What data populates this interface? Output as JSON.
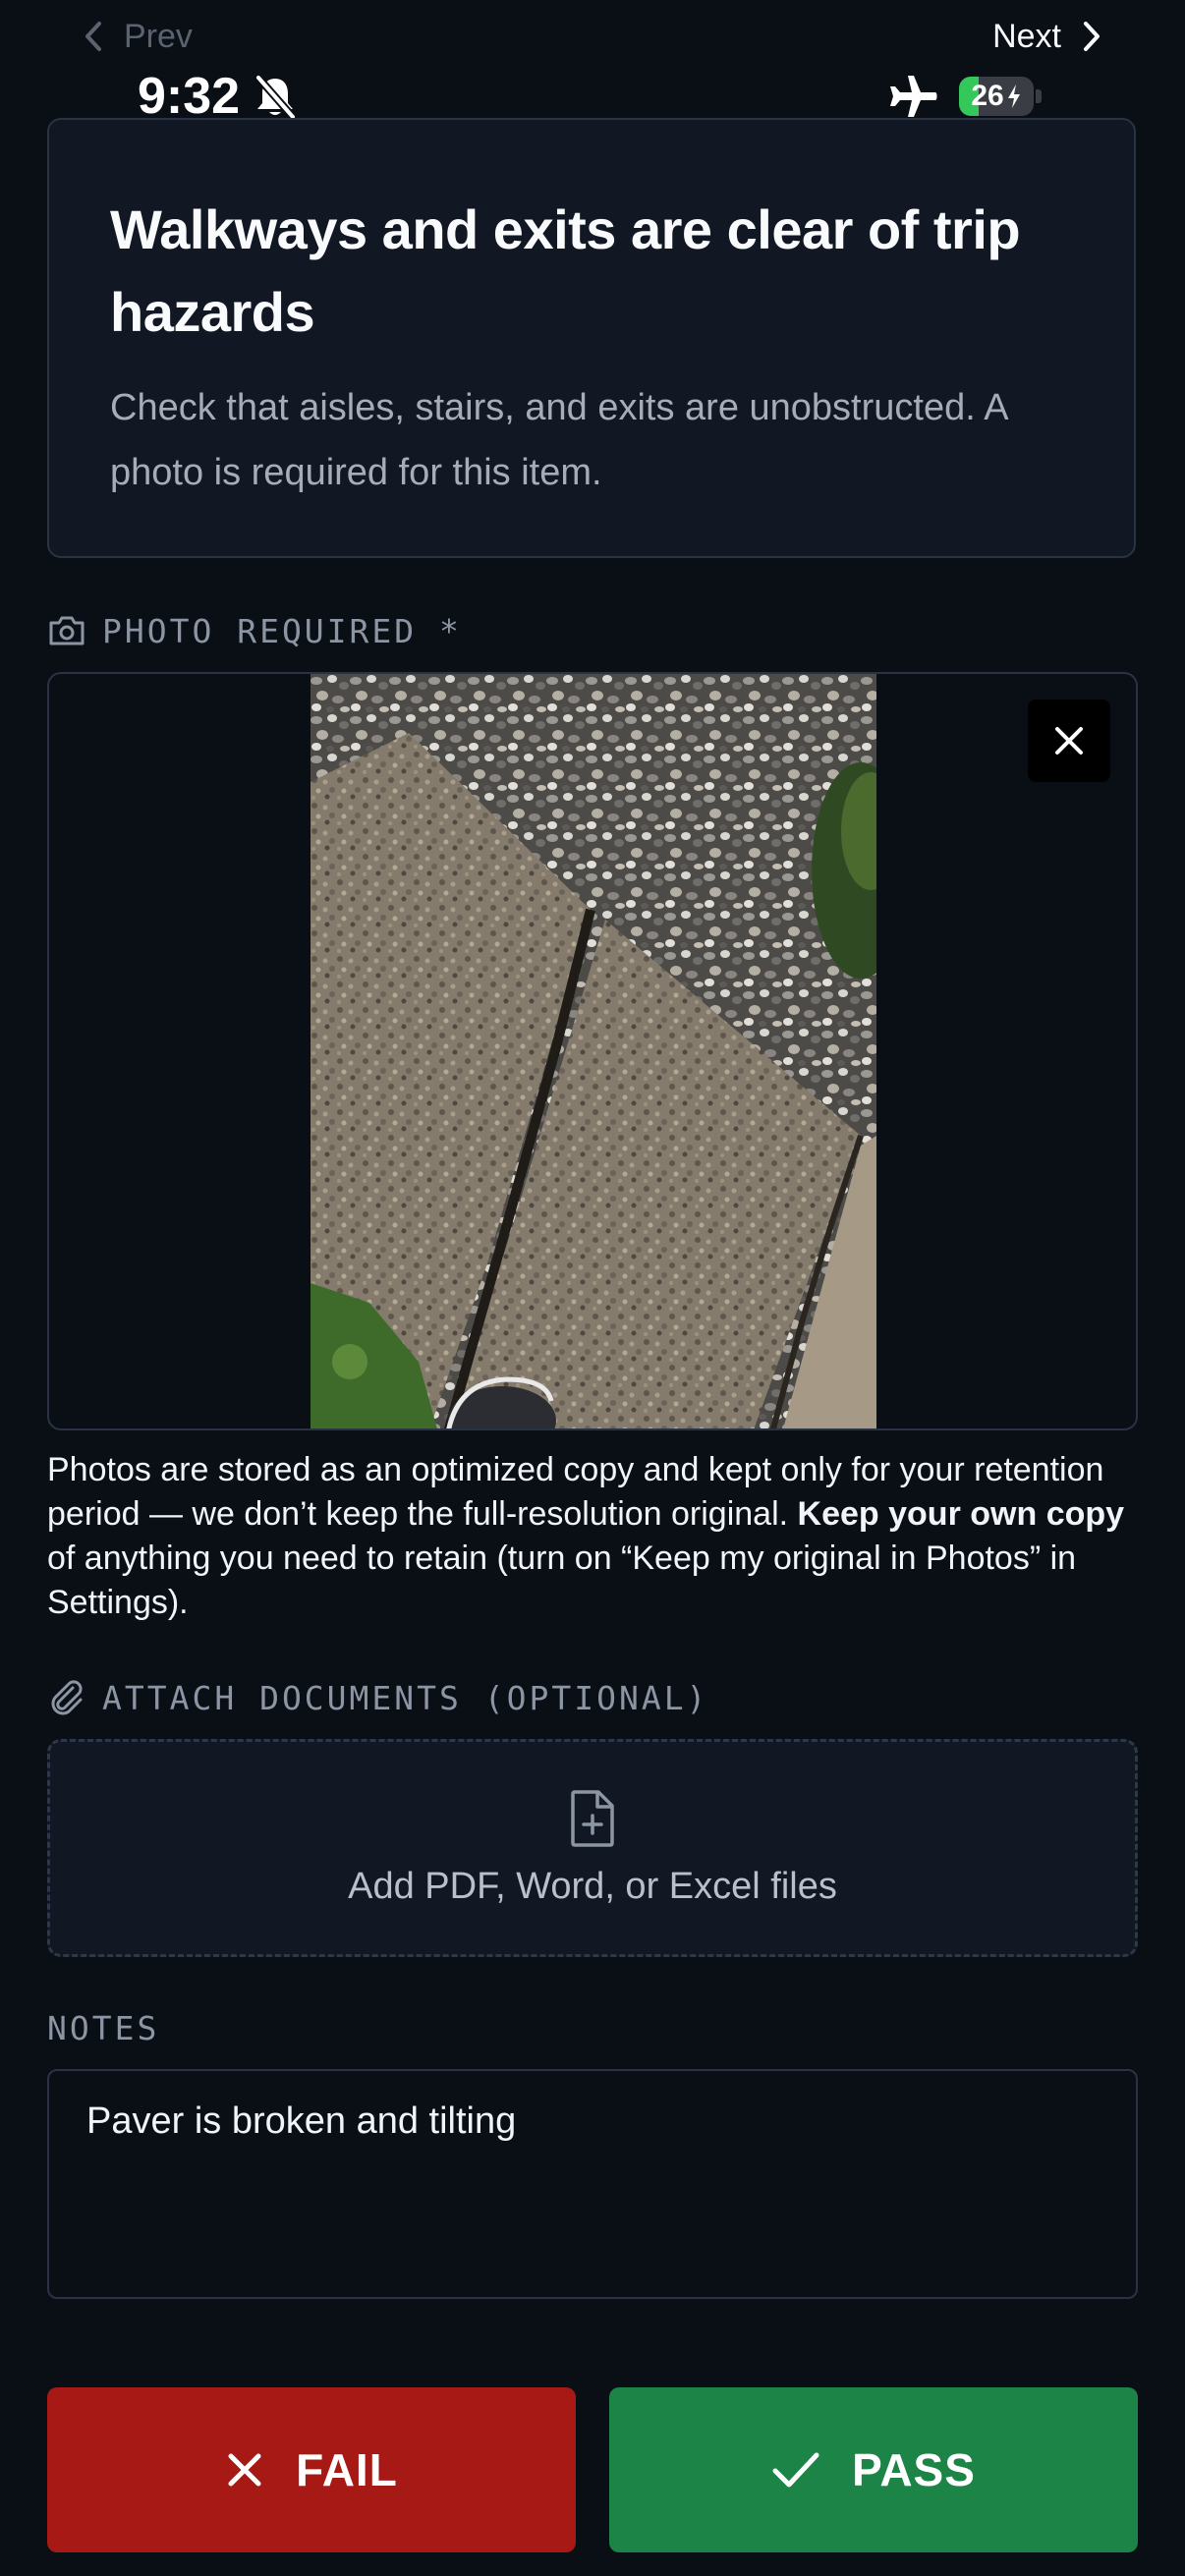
{
  "nav": {
    "prev_label": "Prev",
    "next_label": "Next"
  },
  "status_bar": {
    "time": "9:32",
    "battery": "26",
    "battery_level": 0.26,
    "icons": [
      "bell-slash-icon",
      "airplane-icon",
      "battery-charging-icon"
    ]
  },
  "item": {
    "title": "Walkways and exits are clear of trip hazards",
    "description": "Check that aisles, stairs, and exits are unobstructed. A photo is required for this item."
  },
  "photo_section": {
    "label": "PHOTO REQUIRED *",
    "icon": "camera-icon",
    "note_part1": "Photos are stored as an optimized copy and kept only for your retention period — we don’t keep the full-resolution original. ",
    "note_bold": "Keep your own copy",
    "note_part2": " of anything you need to retain (turn on “Keep my original in Photos” in Settings)."
  },
  "attach_section": {
    "label": "ATTACH DOCUMENTS (OPTIONAL)",
    "icon": "paperclip-icon",
    "dropzone_text": "Add PDF, Word, or Excel files"
  },
  "notes_section": {
    "label": "NOTES",
    "value": "Paver is broken and tilting"
  },
  "actions": {
    "fail_label": "FAIL",
    "pass_label": "PASS"
  },
  "colors": {
    "fail": "#a71915",
    "pass": "#1c8447",
    "background": "#0a0e15",
    "card": "#111723"
  }
}
